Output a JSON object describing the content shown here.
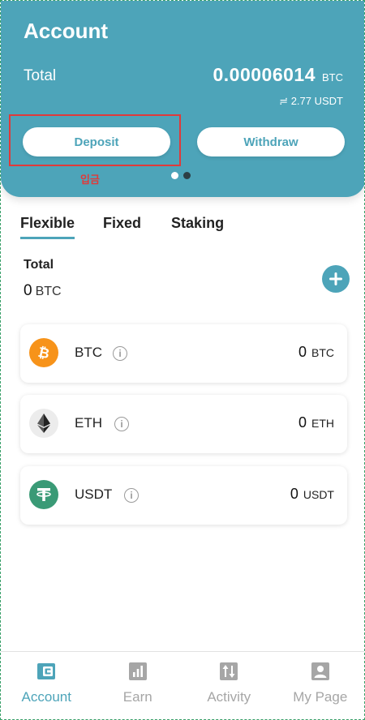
{
  "header": {
    "title": "Account",
    "total_label": "Total",
    "total_value": "0.00006014",
    "total_unit": "BTC",
    "approx_value": "≓ 2.77 USDT",
    "deposit_label": "Deposit",
    "withdraw_label": "Withdraw",
    "annotation": "입금"
  },
  "tabs": [
    {
      "label": "Flexible",
      "active": true
    },
    {
      "label": "Fixed",
      "active": false
    },
    {
      "label": "Staking",
      "active": false
    }
  ],
  "summary": {
    "label": "Total",
    "value": "0",
    "unit": "BTC"
  },
  "assets": [
    {
      "name": "BTC",
      "balance": "0",
      "unit": "BTC",
      "icon": "bitcoin-icon",
      "color": "#f7931a"
    },
    {
      "name": "ETH",
      "balance": "0",
      "unit": "ETH",
      "icon": "ethereum-icon",
      "color": "#ececec"
    },
    {
      "name": "USDT",
      "balance": "0",
      "unit": "USDT",
      "icon": "tether-icon",
      "color": "#3a9a76"
    }
  ],
  "bottom_nav": [
    {
      "label": "Account",
      "icon": "wallet-icon",
      "active": true
    },
    {
      "label": "Earn",
      "icon": "bar-chart-icon",
      "active": false
    },
    {
      "label": "Activity",
      "icon": "swap-arrows-icon",
      "active": false
    },
    {
      "label": "My Page",
      "icon": "profile-icon",
      "active": false
    }
  ],
  "colors": {
    "accent": "#4da4b9",
    "highlight": "#e03a3a",
    "nav_inactive": "#a6a6a6"
  }
}
